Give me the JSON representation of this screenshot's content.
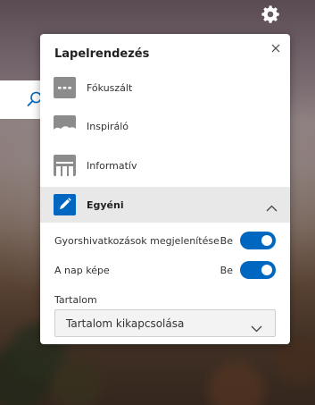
{
  "panel": {
    "title": "Lapelrendezés",
    "layouts": [
      {
        "label": "Fókuszált",
        "icon": "layout-focused-icon"
      },
      {
        "label": "Inspiráló",
        "icon": "layout-inspirational-icon"
      },
      {
        "label": "Informatív",
        "icon": "layout-informational-icon"
      },
      {
        "label": "Egyéni",
        "icon": "layout-custom-pencil-icon",
        "selected": true,
        "expanded": true
      }
    ],
    "custom": {
      "quick_links": {
        "label": "Gyorshivatkozások megjelenítése",
        "state": "Be",
        "on": true
      },
      "image_of_day": {
        "label": "A nap képe",
        "state": "Be",
        "on": true
      },
      "content": {
        "label": "Tartalom",
        "selected": "Tartalom kikapcsolása"
      }
    }
  },
  "colors": {
    "accent": "#0067c0",
    "selected_row": "#e8e8e8",
    "panel_bg": "#ffffff"
  },
  "icons": [
    "gear-icon",
    "close-icon",
    "search-icon",
    "chevron-up-icon",
    "chevron-down-icon"
  ]
}
